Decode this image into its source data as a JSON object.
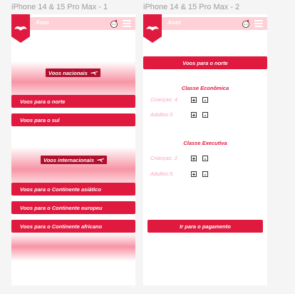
{
  "frames": [
    {
      "title": "iPhone 14 & 15 Pro Max - 1"
    },
    {
      "title": "iPhone 14 & 15 Pro Max - 2"
    }
  ],
  "header": {
    "brand": "Asas"
  },
  "screen1": {
    "national_label": "Voos nacionais",
    "north": "Voos para o norte",
    "south": "Voos para o sul",
    "international_label": "Voos internacionais",
    "asia": "Voos para o Continente asiático",
    "europe": "Voos para o Continente europeu",
    "africa": "Voos para o Continente africano"
  },
  "screen2": {
    "banner": "Voos para o norte",
    "economy": {
      "title": "Classe Econômica",
      "children": "Crianças: 4",
      "adults": "Adultos:3"
    },
    "executive": {
      "title": "Classe Executiva",
      "children": "Crianças: 2",
      "adults": "Adultos:5"
    },
    "stepper": {
      "plus": "+",
      "minus": "-"
    },
    "pay": "Ir para o pagamento"
  },
  "colors": {
    "accent": "#e0193f",
    "dark_accent": "#b0102e",
    "header_bg": "#ffd0d6",
    "muted_text": "#f4a6b5"
  },
  "icons": [
    "eagle-logo-icon",
    "hello-kitty-bow-icon",
    "hamburger-menu-icon",
    "airplane-icon"
  ]
}
